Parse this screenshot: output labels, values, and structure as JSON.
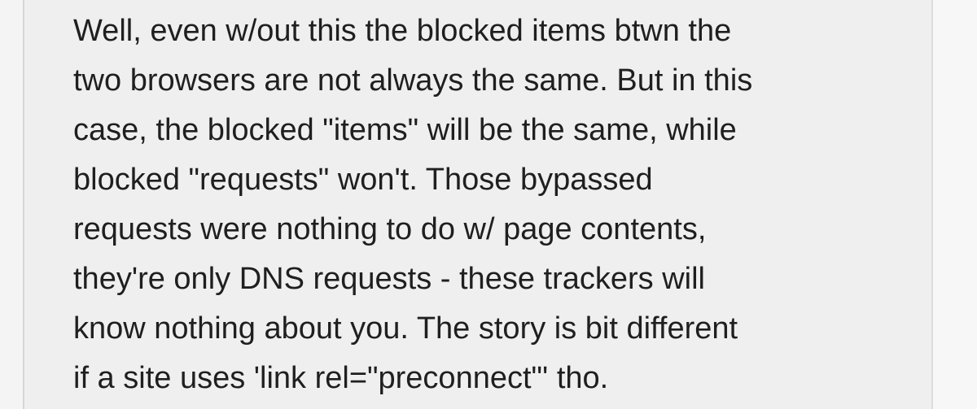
{
  "comment": {
    "lines": [
      "Well, even w/out this the blocked items btwn the",
      "two browsers are not always the same. But in this",
      "case, the blocked \"items\" will be the same, while",
      "blocked \"requests\" won't. Those bypassed",
      "requests were nothing to do w/ page contents,",
      "they're only DNS requests - these trackers will",
      "know nothing about you. The story is bit different",
      "if a site uses 'link rel=\"preconnect\"' tho."
    ]
  }
}
